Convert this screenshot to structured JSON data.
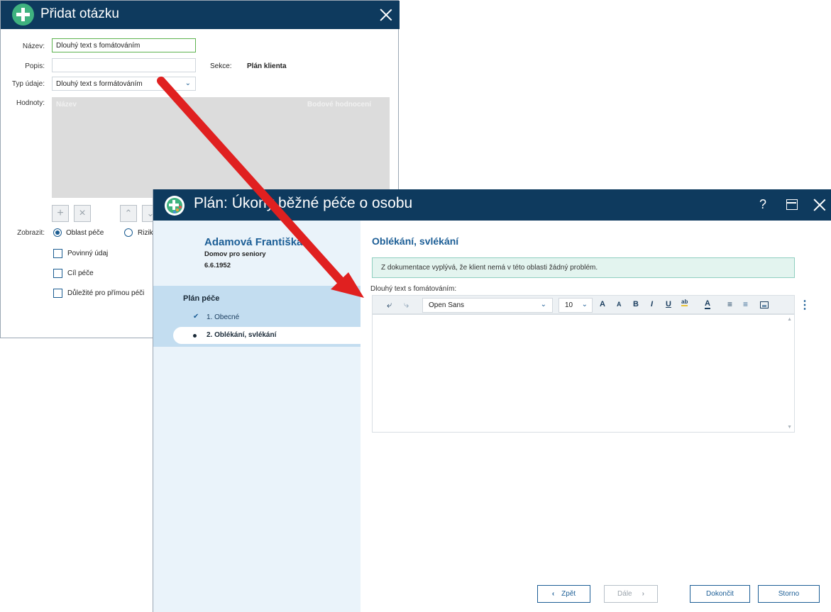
{
  "dialog1": {
    "title": "Přidat otázku",
    "name_label": "Název:",
    "name_value": "Dlouhý text s fomátováním",
    "desc_label": "Popis:",
    "desc_value": "",
    "section_label": "Sekce:",
    "section_value": "Plán klienta",
    "type_label": "Typ údaje:",
    "type_value": "Dlouhý text s formátováním",
    "values_label": "Hodnoty:",
    "grid_col_name": "Název",
    "grid_col_score": "Bodové hodnocení",
    "show_label": "Zobrazit:",
    "radio_oblast": "Oblast péče",
    "radio_riziko": "Riziko",
    "chk_povinny": "Povinný údaj",
    "chk_cil": "Cíl péče",
    "chk_dulezite": "Důležité pro přímou péči"
  },
  "dialog2": {
    "title": "Plán: Úkony běžné péče o osobu",
    "help_icon": "?",
    "client_name": "Adamová Františka",
    "client_facility": "Domov pro seniory",
    "client_dob": "6.6.1952",
    "plan_title": "Plán péče",
    "steps": [
      {
        "label": "1. Obecné",
        "state": "done"
      },
      {
        "label": "2. Oblékání, svlékání",
        "state": "active"
      }
    ],
    "section_title": "Oblékání, svlékání",
    "info_text": "Z dokumentace vyplývá, že klient nemá v této oblasti žádný problém.",
    "field_label": "Dlouhý text s fomátováním:",
    "toolbar": {
      "font": "Open Sans",
      "size": "10",
      "grow_font": "A",
      "shrink_font": "A",
      "bold": "B",
      "italic": "I",
      "underline": "U",
      "highlight": "ab",
      "font_color": "A"
    },
    "buttons": {
      "back": "Zpět",
      "next": "Dále",
      "finish": "Dokončit",
      "cancel": "Storno"
    }
  },
  "colors": {
    "titlebar": "#0e3a5e",
    "accent_blue": "#1c5e96",
    "green": "#3fb27f",
    "annotation_arrow": "#e02020"
  }
}
